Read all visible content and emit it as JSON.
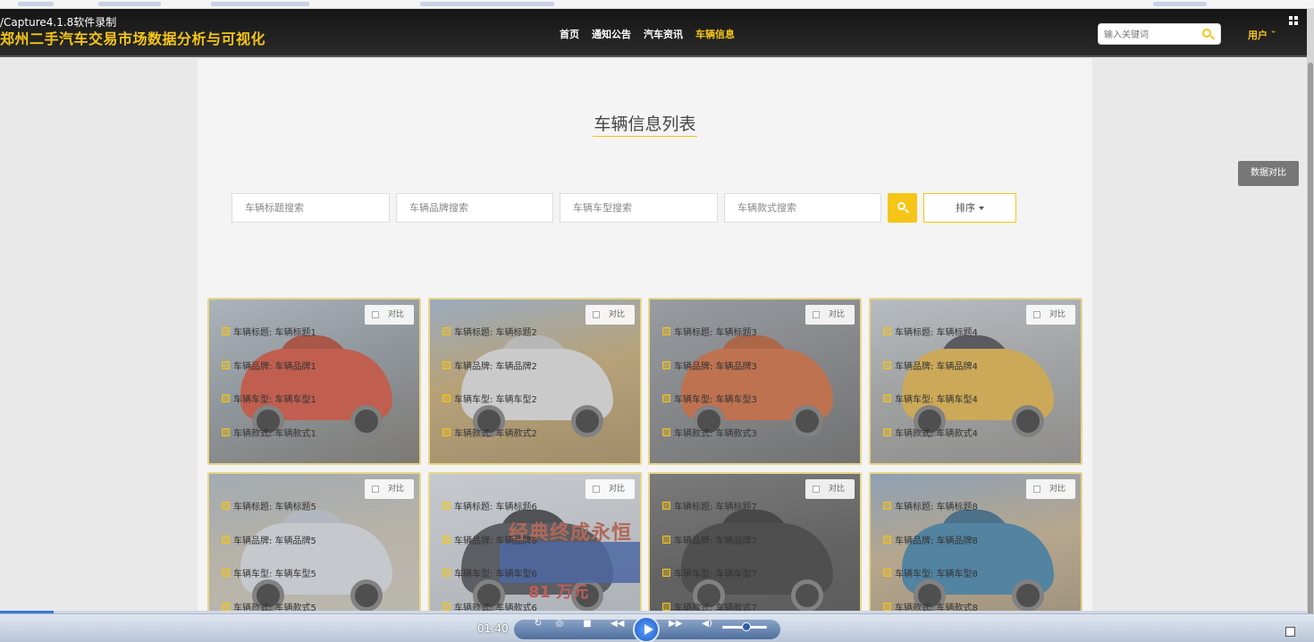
{
  "capture_label": "/Capture4.1.8软件录制",
  "site": {
    "title": "郑州二手汽车交易市场数据分析与可视化"
  },
  "nav": [
    {
      "label": "首页",
      "active": false
    },
    {
      "label": "通知公告",
      "active": false
    },
    {
      "label": "汽车资讯",
      "active": false
    },
    {
      "label": "车辆信息",
      "active": true
    }
  ],
  "header_search": {
    "placeholder": "输入关键词"
  },
  "user_menu": "用户 ˇ",
  "page_title": "车辆信息列表",
  "filters": {
    "title_placeholder": "车辆标题搜索",
    "brand_placeholder": "车辆品牌搜索",
    "model_placeholder": "车辆车型搜索",
    "style_placeholder": "车辆款式搜索",
    "sort_label": "排序"
  },
  "side_compare": "数据对比",
  "compare_label": "对比",
  "cards": [
    {
      "title": "车辆标题: 车辆标题1",
      "brand": "车辆品牌: 车辆品牌1",
      "model": "车辆车型: 车辆车型1",
      "style": "车辆款式: 车辆款式1"
    },
    {
      "title": "车辆标题: 车辆标题2",
      "brand": "车辆品牌: 车辆品牌2",
      "model": "车辆车型: 车辆车型2",
      "style": "车辆款式: 车辆款式2"
    },
    {
      "title": "车辆标题: 车辆标题3",
      "brand": "车辆品牌: 车辆品牌3",
      "model": "车辆车型: 车辆车型3",
      "style": "车辆款式: 车辆款式3"
    },
    {
      "title": "车辆标题: 车辆标题4",
      "brand": "车辆品牌: 车辆品牌4",
      "model": "车辆车型: 车辆车型4",
      "style": "车辆款式: 车辆款式4"
    },
    {
      "title": "车辆标题: 车辆标题5",
      "brand": "车辆品牌: 车辆品牌5",
      "model": "车辆车型: 车辆车型5",
      "style": "车辆款式: 车辆款式5"
    },
    {
      "title": "车辆标题: 车辆标题6",
      "brand": "车辆品牌: 车辆品牌6",
      "model": "车辆车型: 车辆车型6",
      "style": "车辆款式: 车辆款式6"
    },
    {
      "title": "车辆标题: 车辆标题7",
      "brand": "车辆品牌: 车辆品牌7",
      "model": "车辆车型: 车辆车型7",
      "style": "车辆款式: 车辆款式7"
    },
    {
      "title": "车辆标题: 车辆标题8",
      "brand": "车辆品牌: 车辆品牌8",
      "model": "车辆车型: 车辆车型8",
      "style": "车辆款式: 车辆款式8"
    }
  ],
  "promo": {
    "headline": "经典终成永恒",
    "price": "81 万元"
  },
  "player": {
    "time": "01:40"
  },
  "colors": {
    "accent": "#f5c518",
    "header_bg": "#1e1e1e"
  }
}
